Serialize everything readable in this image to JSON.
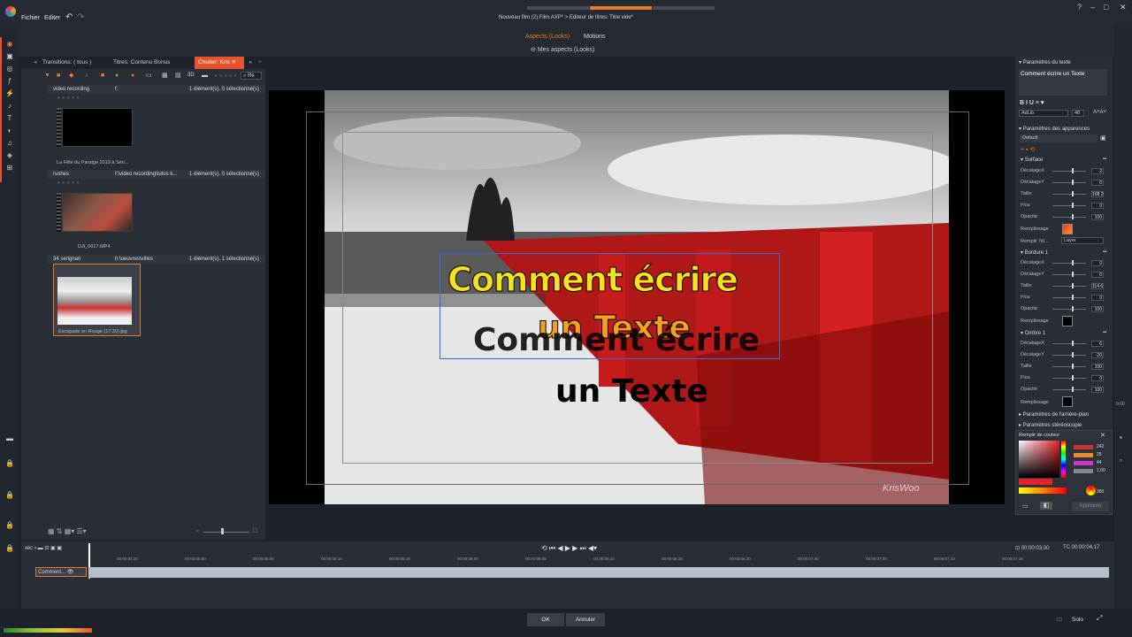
{
  "menu": {
    "file": "Fichier",
    "edit": "Editer"
  },
  "window_title": "Nouveau film (2).Film.AXP* > Editeur de titres: Titre vide*",
  "subheader": {
    "tab_looks": "Aspects (Looks)",
    "tab_motions": "Motions",
    "my_looks": "Mes aspects (Looks)"
  },
  "library": {
    "tabs": [
      "Transitions: ( tous )",
      "Titres: Contenu Bonus",
      "Chutier: Kris"
    ],
    "search_placeholder": "Re",
    "groups": [
      {
        "name": "video recording",
        "path": "f:",
        "count": "1 élément(s), 0 sélectionné(s)",
        "item": "La Fête du Paratge 2019 à Séri..."
      },
      {
        "name": "rushes",
        "path": "f:\\video recording\\tutos k...",
        "count": "1 élément(s), 0 sélectionné(s)",
        "item": "DJI_0017.MP4"
      },
      {
        "name": "34 serignan",
        "path": "h:\\oeuvres\\villes",
        "count": "1 élément(s), 1 sélectionné(s)",
        "item": "Escapade en Rouge (17:30).jpg"
      }
    ]
  },
  "preview": {
    "title_line1": "Comment écrire",
    "title_line2": "un Texte",
    "watermark": "KrisWoo"
  },
  "props": {
    "text_params": "Paramètres du texte",
    "text_value": "Comment écrire un Texte",
    "font": "AdLib",
    "font_size": "48",
    "appearance_params": "Paramètres des apparences",
    "preset": "Default",
    "surface": "Surface",
    "surface_rows": [
      {
        "label": "DécalageX",
        "value": "2"
      },
      {
        "label": "DécalageY",
        "value": "0"
      },
      {
        "label": "Taille",
        "value": "108.2"
      },
      {
        "label": "Flou",
        "value": "0"
      },
      {
        "label": "Opacité",
        "value": "100"
      }
    ],
    "fill_label": "Remplissage",
    "fill_with_label": "Remplir l'él...",
    "fill_with_value": "Layer",
    "border": "Bordure 1",
    "border_rows": [
      {
        "label": "DécalageX",
        "value": "0"
      },
      {
        "label": "DécalageY",
        "value": "0"
      },
      {
        "label": "Taille",
        "value": "114.6"
      },
      {
        "label": "Flou",
        "value": "0"
      },
      {
        "label": "Opacité",
        "value": "100"
      }
    ],
    "shadow": "Ombre 1",
    "shadow_rows": [
      {
        "label": "DécalageX",
        "value": "6"
      },
      {
        "label": "DécalageY",
        "value": "-20"
      },
      {
        "label": "Taille",
        "value": "100"
      },
      {
        "label": "Flou",
        "value": "0"
      },
      {
        "label": "Opacité",
        "value": "100"
      }
    ],
    "bg_params": "Paramètres de l'arrière-plan",
    "stereo_params": "Paramètres stéréoscopie",
    "color_fill": "Remplir de couleur",
    "color_values": [
      "242",
      "25",
      "44",
      "1.00",
      "360"
    ],
    "apply": "Appliquer"
  },
  "timeline": {
    "clip_label": "Comment...",
    "tc_left": "00:00:03.00",
    "tc_right": "00:00:04.17",
    "ticks": [
      "00:00:04.20",
      "00:00:05.00",
      "00:00:05.05",
      "00:00:05.10",
      "00:00:05.15",
      "00:00:06.00",
      "00:00:06.05",
      "00:00:06.10",
      "00:00:06.15",
      "00:00:06.20",
      "00:00:07.00",
      "00:00:07.05",
      "00:00:07.10",
      "00:00:07.15"
    ]
  },
  "footer": {
    "ok": "OK",
    "cancel": "Annuler",
    "solo": "Solo"
  },
  "colors": {
    "accent": "#e87b27",
    "active_tab": "#e8532b"
  }
}
